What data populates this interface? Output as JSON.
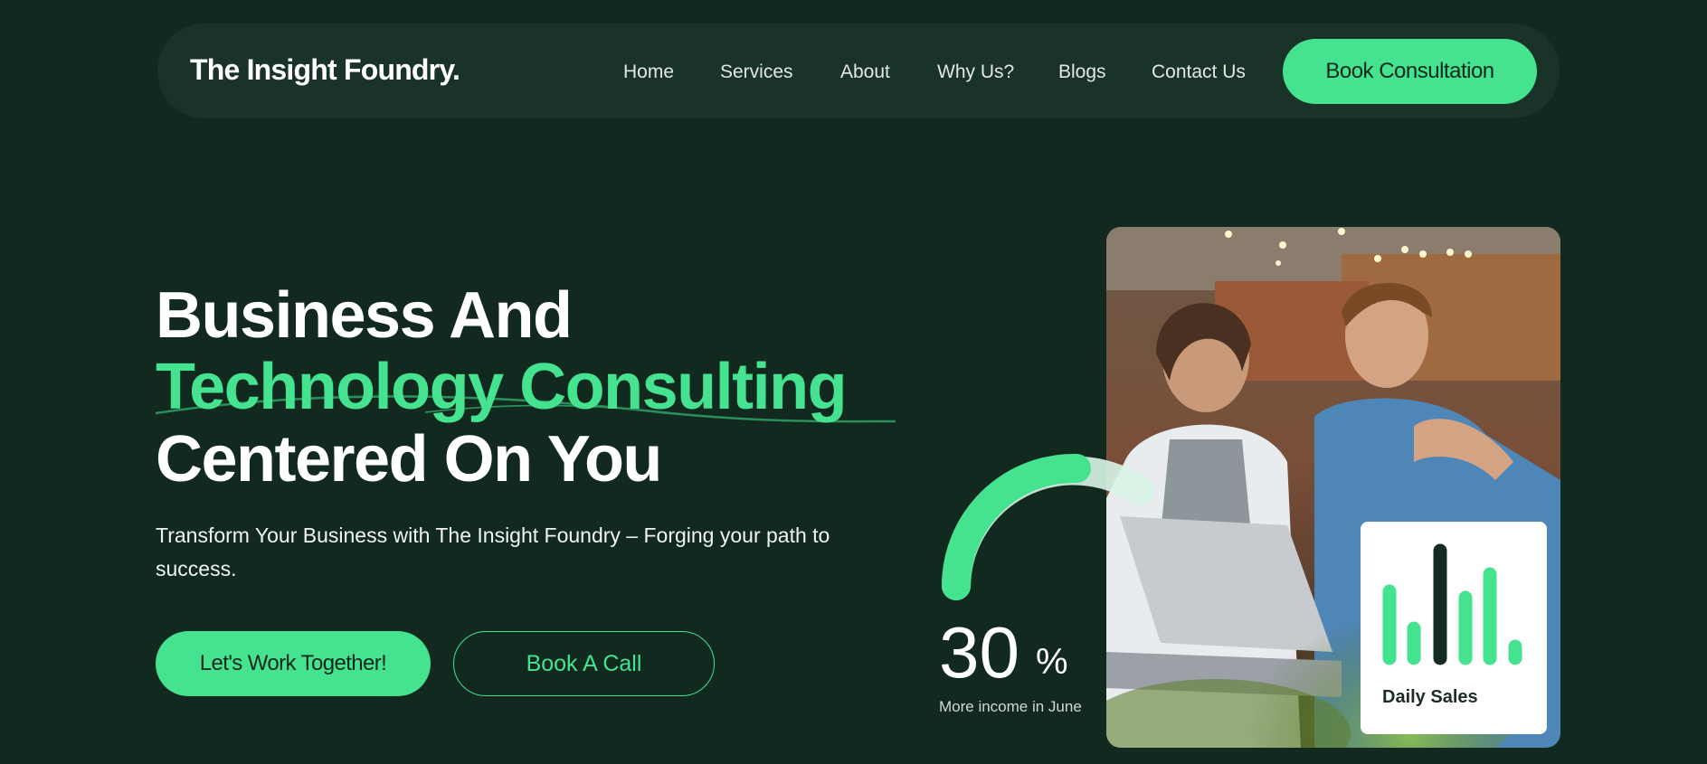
{
  "header": {
    "logo": "The Insight Foundry.",
    "nav": [
      "Home",
      "Services",
      "About",
      "Why Us?",
      "Blogs",
      "Contact Us"
    ],
    "cta": "Book Consultation"
  },
  "hero": {
    "title_line1": "Business And",
    "title_line2": "Technology Consulting",
    "title_line3": "Centered On You",
    "subtitle": "Transform Your Business with The Insight Foundry – Forging your path to success.",
    "primary_button": "Let's Work Together!",
    "secondary_button": "Book A Call"
  },
  "stat": {
    "value": "30",
    "unit": "%",
    "label": "More income in June"
  },
  "sales_card": {
    "title": "Daily Sales"
  },
  "colors": {
    "background": "#11291f",
    "nav_background": "#1a3328",
    "accent": "#45e38f",
    "text": "#ffffff"
  }
}
